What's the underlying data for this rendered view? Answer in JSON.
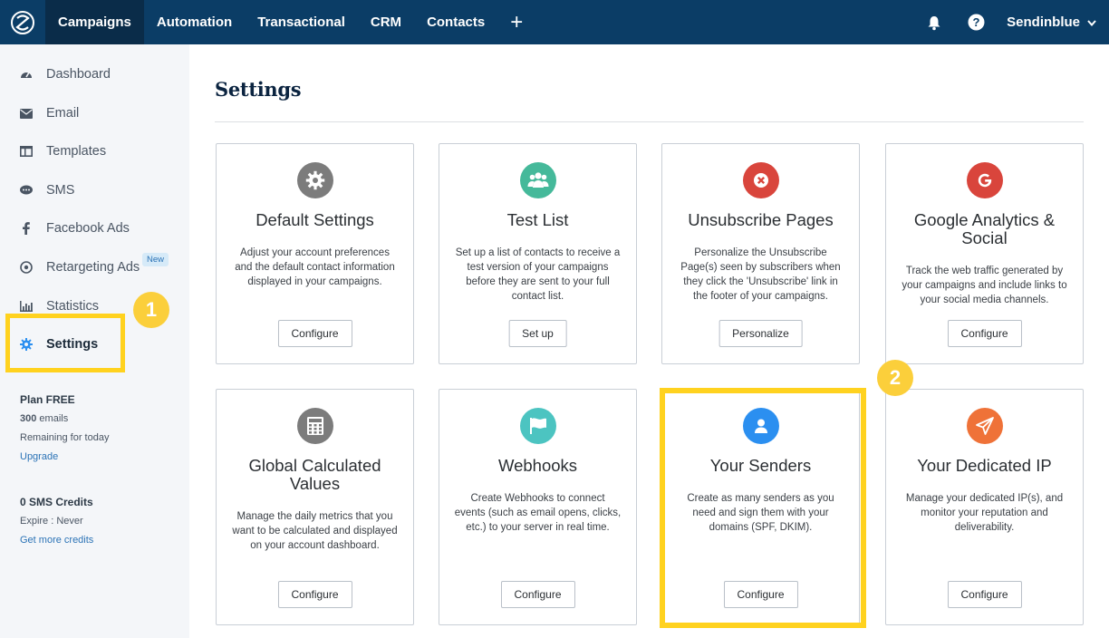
{
  "topnav": {
    "items": [
      {
        "label": "Campaigns",
        "active": true
      },
      {
        "label": "Automation"
      },
      {
        "label": "Transactional"
      },
      {
        "label": "CRM"
      },
      {
        "label": "Contacts"
      }
    ],
    "plus": "+",
    "account": "Sendinblue"
  },
  "sidebar": {
    "items": [
      {
        "label": "Dashboard",
        "icon": "gauge-icon"
      },
      {
        "label": "Email",
        "icon": "envelope-icon"
      },
      {
        "label": "Templates",
        "icon": "layout-icon"
      },
      {
        "label": "SMS",
        "icon": "chat-icon"
      },
      {
        "label": "Facebook Ads",
        "icon": "facebook-icon"
      },
      {
        "label": "Retargeting Ads",
        "icon": "target-icon"
      },
      {
        "label": "Statistics",
        "icon": "bar-chart-icon"
      },
      {
        "label": "Settings",
        "icon": "gear-icon",
        "active": true
      }
    ],
    "new_badge": "New",
    "plan": {
      "title": "Plan FREE",
      "emails_count": "300",
      "emails_label": " emails",
      "remaining": "Remaining for today",
      "upgrade": "Upgrade"
    },
    "sms": {
      "title": "0 SMS Credits",
      "expire": "Expire : Never",
      "link": "Get more credits"
    }
  },
  "steps": [
    "1",
    "2"
  ],
  "main": {
    "title": "Settings",
    "cards": [
      {
        "title": "Default Settings",
        "desc": "Adjust your account preferences and the default contact information displayed in your campaigns.",
        "button": "Configure",
        "icon": "gear-icon",
        "color": "#7c7c7c"
      },
      {
        "title": "Test List",
        "desc": "Set up a list of contacts to receive a test version of your campaigns before they are sent to your full contact list.",
        "button": "Set up",
        "icon": "users-icon",
        "color": "#45b99a"
      },
      {
        "title": "Unsubscribe Pages",
        "desc": "Personalize the Unsubscribe Page(s) seen by subscribers when they click the 'Unsubscribe' link in the footer of your campaigns.",
        "button": "Personalize",
        "icon": "close-circle-icon",
        "color": "#d9453c"
      },
      {
        "title": "Google Analytics & Social",
        "desc": "Track the web traffic generated by your campaigns and include links to your social media channels.",
        "button": "Configure",
        "icon": "google-icon",
        "color": "#d9453c"
      },
      {
        "title": "Global Calculated Values",
        "desc": "Manage the daily metrics that you want to be calculated and displayed on your account dashboard.",
        "button": "Configure",
        "icon": "calculator-icon",
        "color": "#7c7c7c"
      },
      {
        "title": "Webhooks",
        "desc": "Create Webhooks to connect events (such as email opens, clicks, etc.) to your server in real time.",
        "button": "Configure",
        "icon": "flag-icon",
        "color": "#4cc4c1"
      },
      {
        "title": "Your Senders",
        "desc": "Create as many senders as you need and sign them with your domains (SPF, DKIM).",
        "button": "Configure",
        "icon": "user-icon",
        "color": "#2b8ff0"
      },
      {
        "title": "Your Dedicated IP",
        "desc": "Manage your dedicated IP(s), and monitor your reputation and deliverability.",
        "button": "Configure",
        "icon": "paper-plane-icon",
        "color": "#ef7238"
      }
    ]
  }
}
